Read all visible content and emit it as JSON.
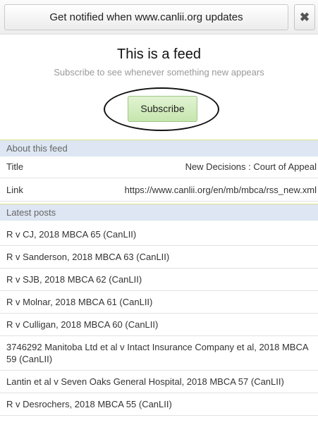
{
  "notify": {
    "label": "Get notified when www.canlii.org updates",
    "close_glyph": "✖"
  },
  "feed": {
    "title": "This is a feed",
    "subtitle": "Subscribe to see whenever something new appears",
    "subscribe_label": "Subscribe"
  },
  "about": {
    "heading": "About this feed",
    "rows": [
      {
        "key": "Title",
        "value": "New Decisions : Court of Appeal"
      },
      {
        "key": "Link",
        "value": "https://www.canlii.org/en/mb/mbca/rss_new.xml"
      }
    ]
  },
  "latest": {
    "heading": "Latest posts",
    "posts": [
      "R v CJ, 2018 MBCA 65 (CanLII)",
      "R v Sanderson, 2018 MBCA 63 (CanLII)",
      "R v SJB, 2018 MBCA 62 (CanLII)",
      "R v Molnar, 2018 MBCA 61 (CanLII)",
      "R v Culligan, 2018 MBCA 60 (CanLII)",
      "3746292 Manitoba Ltd et al v Intact Insurance Company et al, 2018 MBCA 59 (CanLII)",
      "Lantin et al v Seven Oaks General Hospital, 2018 MBCA 57 (CanLII)",
      "R v Desrochers, 2018 MBCA 55 (CanLII)"
    ]
  }
}
